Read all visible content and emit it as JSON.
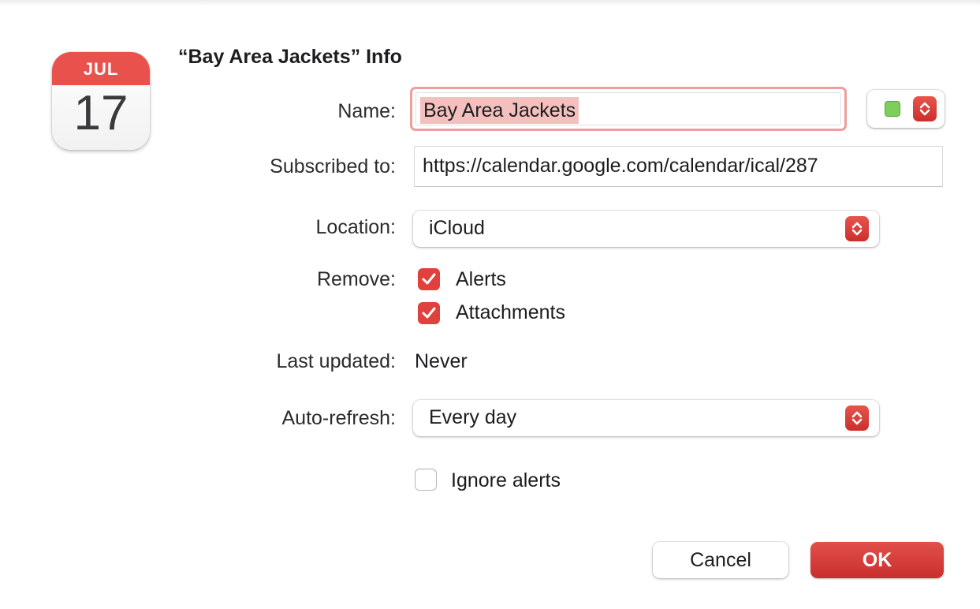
{
  "app_icon": {
    "month": "JUL",
    "day": "17",
    "accent": "#e8514c"
  },
  "dialog": {
    "title": "“Bay Area Jackets” Info"
  },
  "fields": {
    "name": {
      "label": "Name:",
      "value": "Bay Area Jackets",
      "color_swatch": "#7dce5a"
    },
    "subscribed": {
      "label": "Subscribed to:",
      "value": "https://calendar.google.com/calendar/ical/287"
    },
    "location": {
      "label": "Location:",
      "value": "iCloud"
    },
    "remove": {
      "label": "Remove:",
      "options": [
        {
          "label": "Alerts",
          "checked": true
        },
        {
          "label": "Attachments",
          "checked": true
        }
      ]
    },
    "last_updated": {
      "label": "Last updated:",
      "value": "Never"
    },
    "auto_refresh": {
      "label": "Auto-refresh:",
      "value": "Every day"
    },
    "ignore_alerts": {
      "label": "Ignore alerts",
      "checked": false
    }
  },
  "buttons": {
    "cancel": "Cancel",
    "ok": "OK"
  },
  "colors": {
    "accent": "#d93a36",
    "focus_ring": "#ee9e9b",
    "selection": "#f4c0be"
  }
}
